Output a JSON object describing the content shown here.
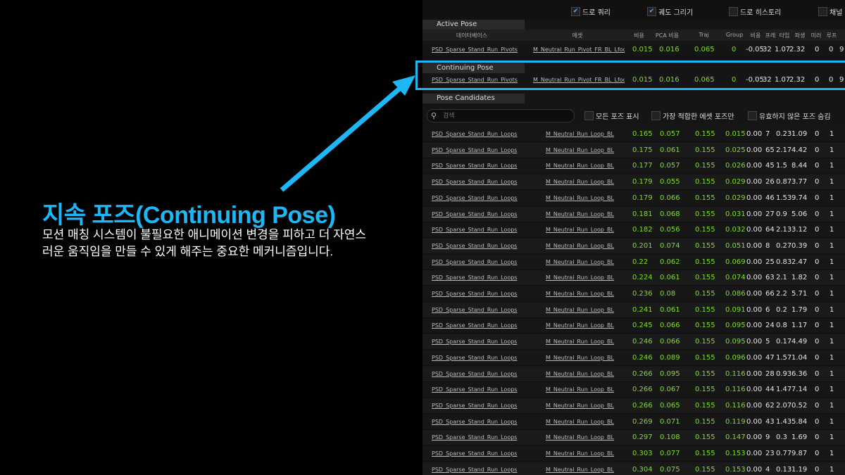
{
  "slide": {
    "title": "지속 포즈(Continuing Pose)",
    "description": "모션 매칭 시스템이 불필요한 애니메이션 변경을 피하고 더 자연스러운 움직임을 만들 수 있게 해주는 중요한 메커니즘입니다."
  },
  "toolbar": {
    "draw_query": "드로 쿼리",
    "draw_trajectory": "궤도 그리기",
    "draw_history": "드로 히스토리",
    "channel": "채널"
  },
  "sections": {
    "active_pose": "Active Pose",
    "continuing_pose": "Continuing Pose",
    "pose_candidates": "Pose Candidates"
  },
  "columns": {
    "database": "데이터베이스",
    "asset": "에셋",
    "cost": "비용",
    "pca_cost": "PCA 비용",
    "traj": "Traj",
    "group": "Group",
    "c5": "비용",
    "c6": "프레",
    "c7": "타임",
    "c8": "파생",
    "c9": "미러",
    "c10": "루프"
  },
  "active_row": {
    "db": "PSD_Sparse_Stand_Run_Pivots",
    "asset": "M_Neutral_Run_Pivot_FR_BL_Lfoot",
    "cost": "0.015",
    "pca": "0.016",
    "traj": "0.065",
    "group": "0",
    "x1": "-0.05",
    "x2": "32",
    "x3": "1.07",
    "x4": "2.32",
    "x5": "0",
    "x6": "0",
    "x7": "9"
  },
  "continuing_row": {
    "db": "PSD_Sparse_Stand_Run_Pivots",
    "asset": "M_Neutral_Run_Pivot_FR_BL_Lfoot",
    "cost": "0.015",
    "pca": "0.016",
    "traj": "0.065",
    "group": "0",
    "x1": "-0.05",
    "x2": "32",
    "x3": "1.07",
    "x4": "2.32",
    "x5": "0",
    "x6": "0",
    "x7": "9"
  },
  "search": {
    "placeholder": "검색"
  },
  "filters": {
    "show_all": "모든 포즈 표시",
    "best_asset_only": "가장 적합한 에셋 포즈만",
    "hide_invalid": "유효하지 않은 포즈 숨김"
  },
  "candidates": [
    {
      "db": "PSD_Sparse_Stand_Run_Loops",
      "asset": "M_Neutral_Run_Loop_BL",
      "cost": "0.165",
      "pca": "0.057",
      "traj": "0.155",
      "group": "0.015",
      "a": "0.00",
      "b": "7",
      "c": "0.23",
      "d": "1.09",
      "e": "0",
      "f": "1"
    },
    {
      "db": "PSD_Sparse_Stand_Run_Loops",
      "asset": "M_Neutral_Run_Loop_BL",
      "cost": "0.175",
      "pca": "0.061",
      "traj": "0.155",
      "group": "0.025",
      "a": "0.00",
      "b": "65",
      "c": "2.17",
      "d": "4.42",
      "e": "0",
      "f": "1"
    },
    {
      "db": "PSD_Sparse_Stand_Run_Loops",
      "asset": "M_Neutral_Run_Loop_BL",
      "cost": "0.177",
      "pca": "0.057",
      "traj": "0.155",
      "group": "0.026",
      "a": "0.00",
      "b": "45",
      "c": "1.5",
      "d": "8.44",
      "e": "0",
      "f": "1"
    },
    {
      "db": "PSD_Sparse_Stand_Run_Loops",
      "asset": "M_Neutral_Run_Loop_BL",
      "cost": "0.179",
      "pca": "0.055",
      "traj": "0.155",
      "group": "0.029",
      "a": "0.00",
      "b": "26",
      "c": "0.87",
      "d": "3.77",
      "e": "0",
      "f": "1"
    },
    {
      "db": "PSD_Sparse_Stand_Run_Loops",
      "asset": "M_Neutral_Run_Loop_BL",
      "cost": "0.179",
      "pca": "0.066",
      "traj": "0.155",
      "group": "0.029",
      "a": "0.00",
      "b": "46",
      "c": "1.53",
      "d": "9.74",
      "e": "0",
      "f": "1"
    },
    {
      "db": "PSD_Sparse_Stand_Run_Loops",
      "asset": "M_Neutral_Run_Loop_BL",
      "cost": "0.181",
      "pca": "0.068",
      "traj": "0.155",
      "group": "0.031",
      "a": "0.00",
      "b": "27",
      "c": "0.9",
      "d": "5.06",
      "e": "0",
      "f": "1"
    },
    {
      "db": "PSD_Sparse_Stand_Run_Loops",
      "asset": "M_Neutral_Run_Loop_BL",
      "cost": "0.182",
      "pca": "0.056",
      "traj": "0.155",
      "group": "0.032",
      "a": "0.00",
      "b": "64",
      "c": "2.13",
      "d": "3.12",
      "e": "0",
      "f": "1"
    },
    {
      "db": "PSD_Sparse_Stand_Run_Loops",
      "asset": "M_Neutral_Run_Loop_BL",
      "cost": "0.201",
      "pca": "0.074",
      "traj": "0.155",
      "group": "0.051",
      "a": "0.00",
      "b": "8",
      "c": "0.27",
      "d": "0.39",
      "e": "0",
      "f": "1"
    },
    {
      "db": "PSD_Sparse_Stand_Run_Loops",
      "asset": "M_Neutral_Run_Loop_BL",
      "cost": "0.22",
      "pca": "0.062",
      "traj": "0.155",
      "group": "0.069",
      "a": "0.00",
      "b": "25",
      "c": "0.83",
      "d": "2.47",
      "e": "0",
      "f": "1"
    },
    {
      "db": "PSD_Sparse_Stand_Run_Loops",
      "asset": "M_Neutral_Run_Loop_BL",
      "cost": "0.224",
      "pca": "0.061",
      "traj": "0.155",
      "group": "0.074",
      "a": "0.00",
      "b": "63",
      "c": "2.1",
      "d": "1.82",
      "e": "0",
      "f": "1"
    },
    {
      "db": "PSD_Sparse_Stand_Run_Loops",
      "asset": "M_Neutral_Run_Loop_BL",
      "cost": "0.236",
      "pca": "0.08",
      "traj": "0.155",
      "group": "0.086",
      "a": "0.00",
      "b": "66",
      "c": "2.2",
      "d": "5.71",
      "e": "0",
      "f": "1"
    },
    {
      "db": "PSD_Sparse_Stand_Run_Loops",
      "asset": "M_Neutral_Run_Loop_BL",
      "cost": "0.241",
      "pca": "0.061",
      "traj": "0.155",
      "group": "0.091",
      "a": "0.00",
      "b": "6",
      "c": "0.2",
      "d": "1.79",
      "e": "0",
      "f": "1"
    },
    {
      "db": "PSD_Sparse_Stand_Run_Loops",
      "asset": "M_Neutral_Run_Loop_BL",
      "cost": "0.245",
      "pca": "0.066",
      "traj": "0.155",
      "group": "0.095",
      "a": "0.00",
      "b": "24",
      "c": "0.8",
      "d": "1.17",
      "e": "0",
      "f": "1"
    },
    {
      "db": "PSD_Sparse_Stand_Run_Loops",
      "asset": "M_Neutral_Run_Loop_BL",
      "cost": "0.246",
      "pca": "0.066",
      "traj": "0.155",
      "group": "0.095",
      "a": "0.00",
      "b": "5",
      "c": "0.17",
      "d": "4.49",
      "e": "0",
      "f": "1"
    },
    {
      "db": "PSD_Sparse_Stand_Run_Loops",
      "asset": "M_Neutral_Run_Loop_BL",
      "cost": "0.246",
      "pca": "0.089",
      "traj": "0.155",
      "group": "0.096",
      "a": "0.00",
      "b": "47",
      "c": "1.57",
      "d": "1.04",
      "e": "0",
      "f": "1"
    },
    {
      "db": "PSD_Sparse_Stand_Run_Loops",
      "asset": "M_Neutral_Run_Loop_BL",
      "cost": "0.266",
      "pca": "0.095",
      "traj": "0.155",
      "group": "0.116",
      "a": "0.00",
      "b": "28",
      "c": "0.93",
      "d": "6.36",
      "e": "0",
      "f": "1"
    },
    {
      "db": "PSD_Sparse_Stand_Run_Loops",
      "asset": "M_Neutral_Run_Loop_BL",
      "cost": "0.266",
      "pca": "0.067",
      "traj": "0.155",
      "group": "0.116",
      "a": "0.00",
      "b": "44",
      "c": "1.47",
      "d": "7.14",
      "e": "0",
      "f": "1"
    },
    {
      "db": "PSD_Sparse_Stand_Run_Loops",
      "asset": "M_Neutral_Run_Loop_BL",
      "cost": "0.266",
      "pca": "0.065",
      "traj": "0.155",
      "group": "0.116",
      "a": "0.00",
      "b": "62",
      "c": "2.07",
      "d": "0.52",
      "e": "0",
      "f": "1"
    },
    {
      "db": "PSD_Sparse_Stand_Run_Loops",
      "asset": "M_Neutral_Run_Loop_BL",
      "cost": "0.269",
      "pca": "0.071",
      "traj": "0.155",
      "group": "0.119",
      "a": "0.00",
      "b": "43",
      "c": "1.43",
      "d": "5.84",
      "e": "0",
      "f": "1"
    },
    {
      "db": "PSD_Sparse_Stand_Run_Loops",
      "asset": "M_Neutral_Run_Loop_BL",
      "cost": "0.297",
      "pca": "0.108",
      "traj": "0.155",
      "group": "0.147",
      "a": "0.00",
      "b": "9",
      "c": "0.3",
      "d": "1.69",
      "e": "0",
      "f": "1"
    },
    {
      "db": "PSD_Sparse_Stand_Run_Loops",
      "asset": "M_Neutral_Run_Loop_BL",
      "cost": "0.303",
      "pca": "0.077",
      "traj": "0.155",
      "group": "0.153",
      "a": "0.00",
      "b": "23",
      "c": "0.77",
      "d": "9.87",
      "e": "0",
      "f": "1"
    },
    {
      "db": "PSD_Sparse_Stand_Run_Loops",
      "asset": "M_Neutral_Run_Loop_BL",
      "cost": "0.304",
      "pca": "0.075",
      "traj": "0.155",
      "group": "0.153",
      "a": "0.00",
      "b": "4",
      "c": "0.13",
      "d": "1.19",
      "e": "0",
      "f": "1"
    }
  ],
  "colors": {
    "accent": "#1eb7f5",
    "value_green": "#7fdc2a",
    "panel_bg": "#151515"
  }
}
